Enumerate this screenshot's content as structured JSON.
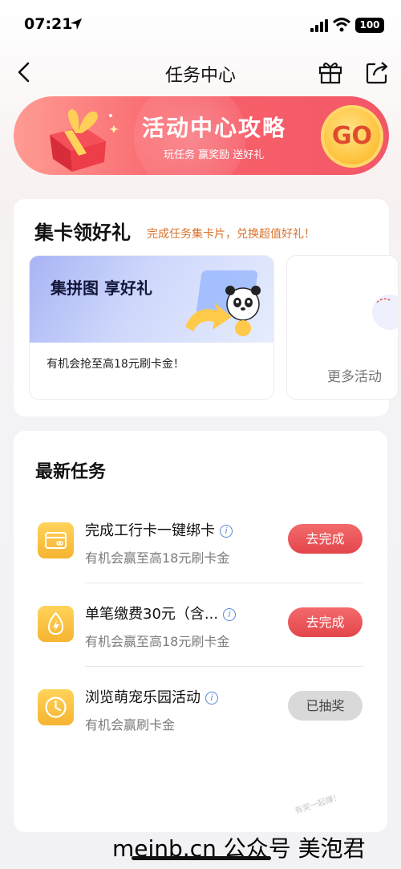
{
  "status_bar": {
    "time": "07:21",
    "battery": "100"
  },
  "nav": {
    "title": "任务中心"
  },
  "banner": {
    "title": "活动中心攻略",
    "subtitle": "玩任务 赢奖励 送好礼",
    "go_label": "GO"
  },
  "collect": {
    "title": "集卡领好礼",
    "subtitle": "完成任务集卡片，兑换超值好礼！",
    "promo": {
      "title": "集拼图 享好礼",
      "desc": "有机会抢至高18元刷卡金！"
    },
    "more_label": "更多活动"
  },
  "tasks_section": {
    "title": "最新任务",
    "tasks": [
      {
        "name": "完成工行卡一键绑卡",
        "desc": "有机会赢至高18元刷卡金",
        "button": "去完成",
        "icon": "card-icon"
      },
      {
        "name": "单笔缴费30元（含...",
        "desc": "有机会赢至高18元刷卡金",
        "button": "去完成",
        "icon": "lightning-icon"
      },
      {
        "name": "浏览萌宠乐园活动",
        "desc": "有机会赢刷卡金",
        "button": "已抽奖",
        "icon": "clock-icon"
      }
    ]
  },
  "watermark": "有奖一起赚！",
  "footer": "meinb.cn  公众号 美泡君",
  "colors": {
    "accent_red": "#e3464b",
    "banner_pink": "#f8626b",
    "task_icon_yellow": "#ffd35a",
    "subtitle_orange": "#d9722b"
  }
}
